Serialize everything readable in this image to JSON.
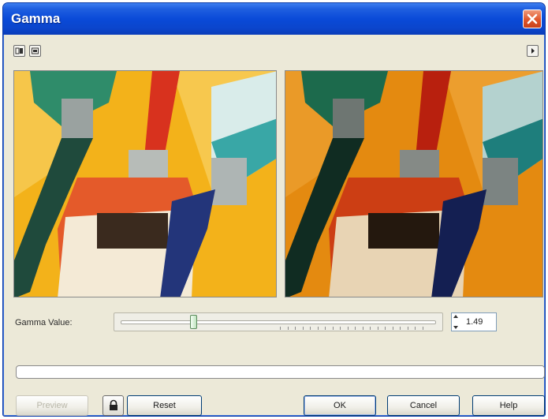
{
  "window": {
    "title": "Gamma",
    "close_icon": "close-icon"
  },
  "toolbar": {
    "left_icons": [
      "dual-preview-icon",
      "single-preview-icon"
    ],
    "right_icon": "expand-arrow-icon"
  },
  "previews": {
    "before_label": "original-preview",
    "after_label": "adjusted-preview"
  },
  "gamma": {
    "label": "Gamma Value:",
    "value": "1.49",
    "slider_fraction": 0.23
  },
  "buttons": {
    "preview": "Preview",
    "lock_icon": "lock-icon",
    "reset": "Reset",
    "ok": "OK",
    "cancel": "Cancel",
    "help": "Help"
  },
  "colors": {
    "title_bar": "#0a4ad8",
    "dialog_bg": "#ece9d8",
    "close_button": "#e0552a"
  }
}
